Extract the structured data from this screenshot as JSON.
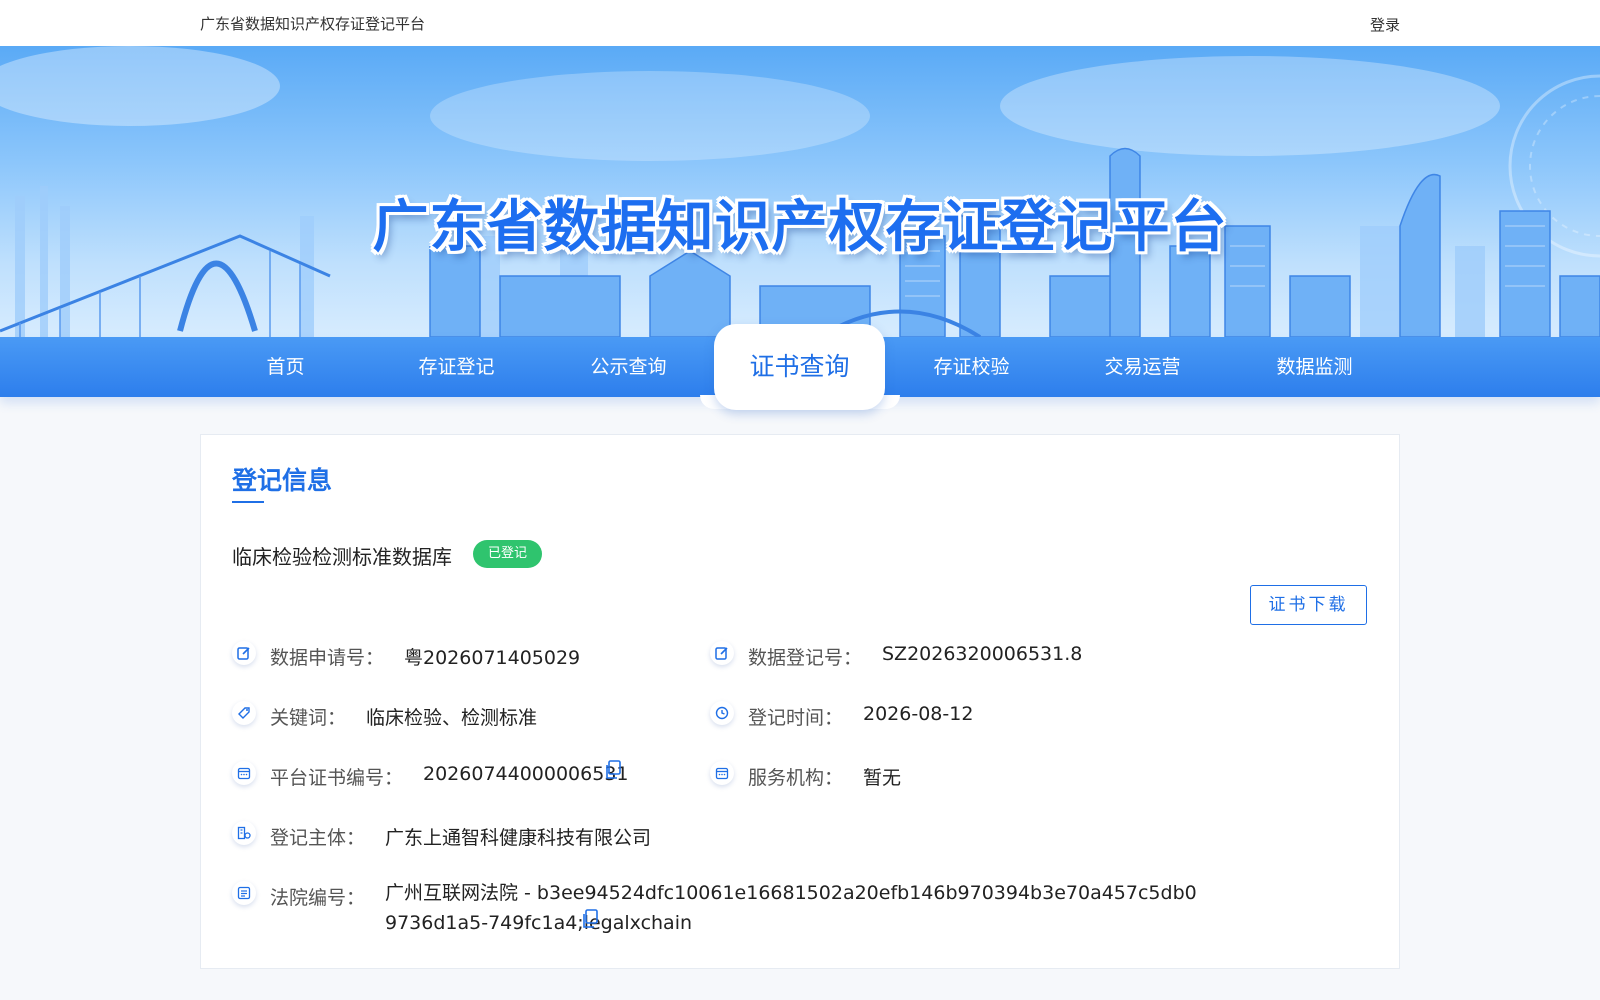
{
  "topbar": {
    "site_title": "广东省数据知识产权存证登记平台",
    "login": "登录"
  },
  "banner": {
    "headline": "广东省数据知识产权存证登记平台"
  },
  "nav": {
    "items": [
      {
        "label": "首页"
      },
      {
        "label": "存证登记"
      },
      {
        "label": "公示查询"
      },
      {
        "label": "证书查询",
        "active": true
      },
      {
        "label": "存证校验"
      },
      {
        "label": "交易运营"
      },
      {
        "label": "数据监测"
      }
    ]
  },
  "registration": {
    "section_title": "登记信息",
    "dataset_name": "临床检验检测标准数据库",
    "status": "已登记",
    "download_button": "证书下载",
    "fields": {
      "application_no": {
        "label": "数据申请号：",
        "value": "粤2026071405029"
      },
      "registration_no": {
        "label": "数据登记号：",
        "value": "SZ2026320006531.8"
      },
      "keywords": {
        "label": "关键词：",
        "value": "临床检验、检测标准"
      },
      "registration_time": {
        "label": "登记时间：",
        "value": "2026-08-12"
      },
      "certificate_no": {
        "label": "平台证书编号：",
        "value": "20260744000006531"
      },
      "service_agency": {
        "label": "服务机构：",
        "value": "暂无"
      },
      "registrant": {
        "label": "登记主体：",
        "value": "广东上通智科健康科技有限公司"
      },
      "court_no": {
        "label": "法院编号：",
        "value": "广州互联网法院 - b3ee94524dfc10061e16681502a20efb146b970394b3e70a457c5db09736d1a5-749fc1a4;legalxchain"
      }
    }
  },
  "colors": {
    "primary": "#1f6fe6",
    "nav_bg": "#2d7eec",
    "status_green": "#2fc46e"
  },
  "icons": {
    "application_no": "edit-icon",
    "registration_no": "edit-icon",
    "keywords": "tag-icon",
    "registration_time": "clock-icon",
    "certificate_no": "calendar-icon",
    "service_agency": "calendar-icon",
    "registrant": "org-icon",
    "court_no": "list-icon",
    "copy": "copy-icon"
  }
}
